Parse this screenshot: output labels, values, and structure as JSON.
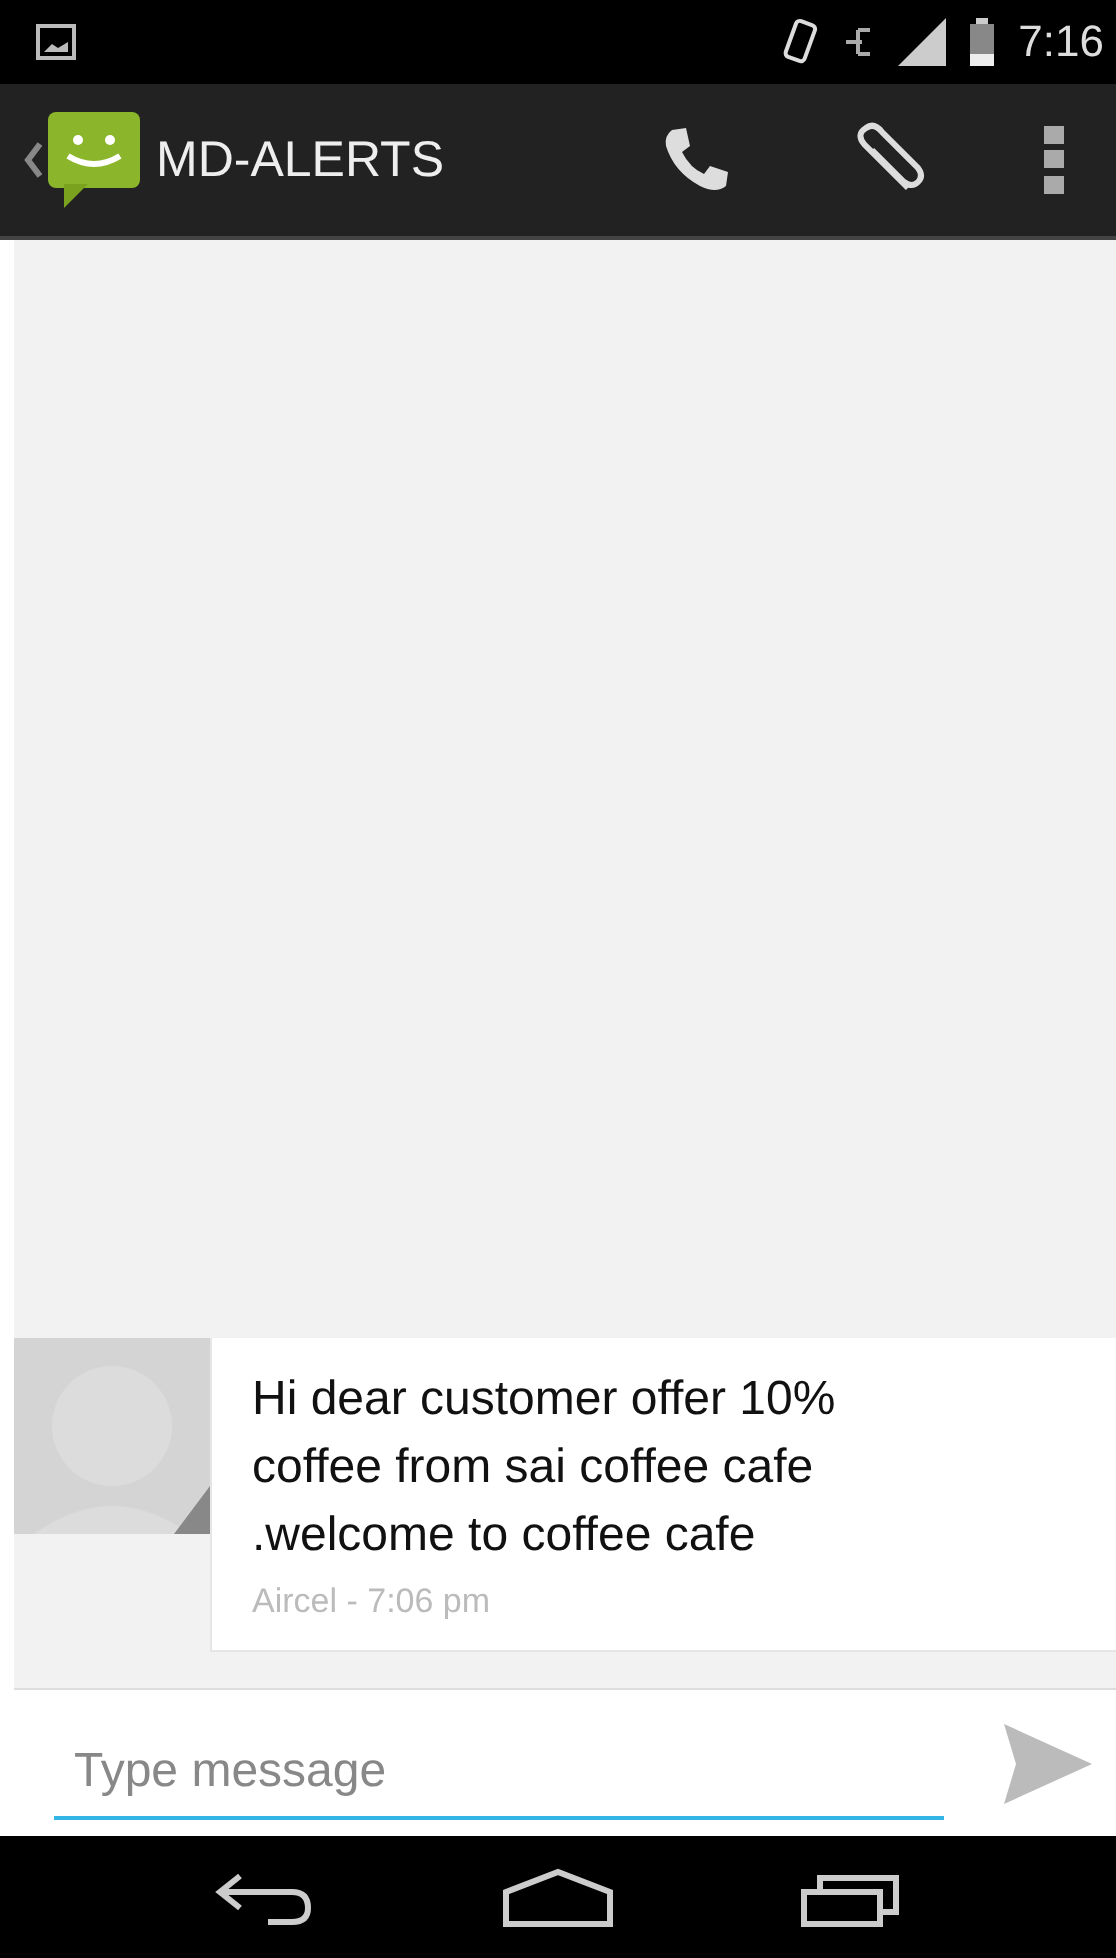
{
  "status_bar": {
    "time": "7:16"
  },
  "action_bar": {
    "title": "MD-ALERTS"
  },
  "messages": [
    {
      "text": "Hi dear customer offer 10% coffee from sai coffee cafe .welcome to coffee cafe",
      "meta": "Aircel - 7:06 pm"
    }
  ],
  "compose": {
    "placeholder": "Type message"
  }
}
